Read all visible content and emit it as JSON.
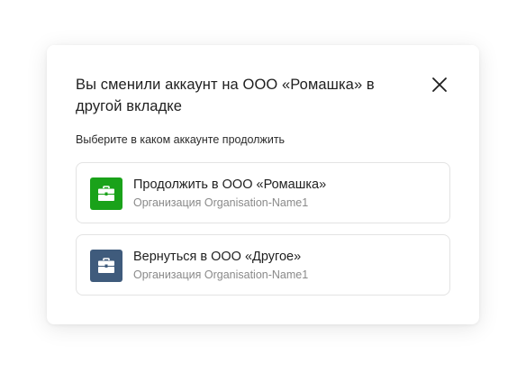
{
  "dialog": {
    "title": "Вы сменили аккаунт на ООО «Ромашка» в другой вкладке",
    "subtitle": "Выберите в каком аккаунте продолжить"
  },
  "options": [
    {
      "title": "Продолжить в ООО «Ромашка»",
      "subtitle": "Организация Organisation-Name1",
      "icon": "briefcase-icon",
      "color": "#1aa21a"
    },
    {
      "title": "Вернуться в ООО «Другое»",
      "subtitle": "Организация Organisation-Name1",
      "icon": "briefcase-icon",
      "color": "#3f5b7c"
    }
  ],
  "icons": {
    "close": "close-icon"
  }
}
